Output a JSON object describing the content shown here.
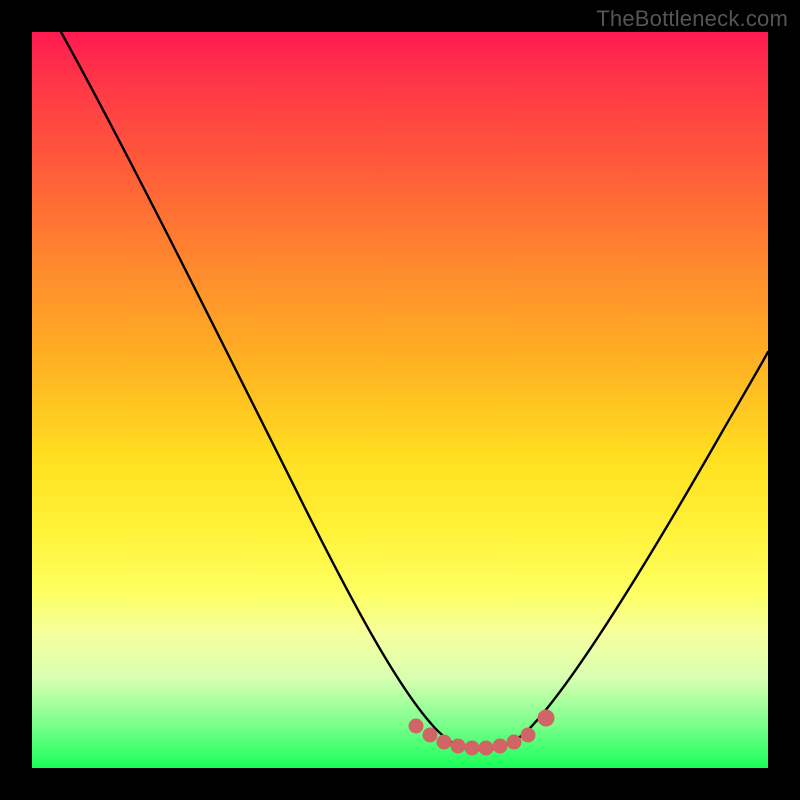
{
  "watermark": {
    "text": "TheBottleneck.com"
  },
  "chart_data": {
    "type": "line",
    "title": "",
    "xlabel": "",
    "ylabel": "",
    "xlim": [
      0,
      100
    ],
    "ylim": [
      0,
      100
    ],
    "grid": false,
    "series": [
      {
        "name": "bottleneck-curve",
        "x": [
          4,
          10,
          18,
          26,
          34,
          42,
          48,
          52,
          55,
          58,
          61,
          64,
          67,
          70,
          74,
          80,
          86,
          92,
          98
        ],
        "y": [
          100,
          88,
          74,
          60,
          46,
          32,
          20,
          12,
          7,
          4,
          3,
          3,
          4,
          7,
          13,
          24,
          37,
          50,
          63
        ]
      }
    ],
    "markers": [
      {
        "name": "valley-dots",
        "color": "#d16464",
        "x": [
          52,
          54,
          56,
          58,
          60,
          62,
          64,
          66,
          68,
          70
        ],
        "y": [
          6.0,
          4.7,
          3.8,
          3.3,
          3.0,
          3.0,
          3.2,
          3.8,
          5.0,
          7.2
        ]
      }
    ]
  }
}
